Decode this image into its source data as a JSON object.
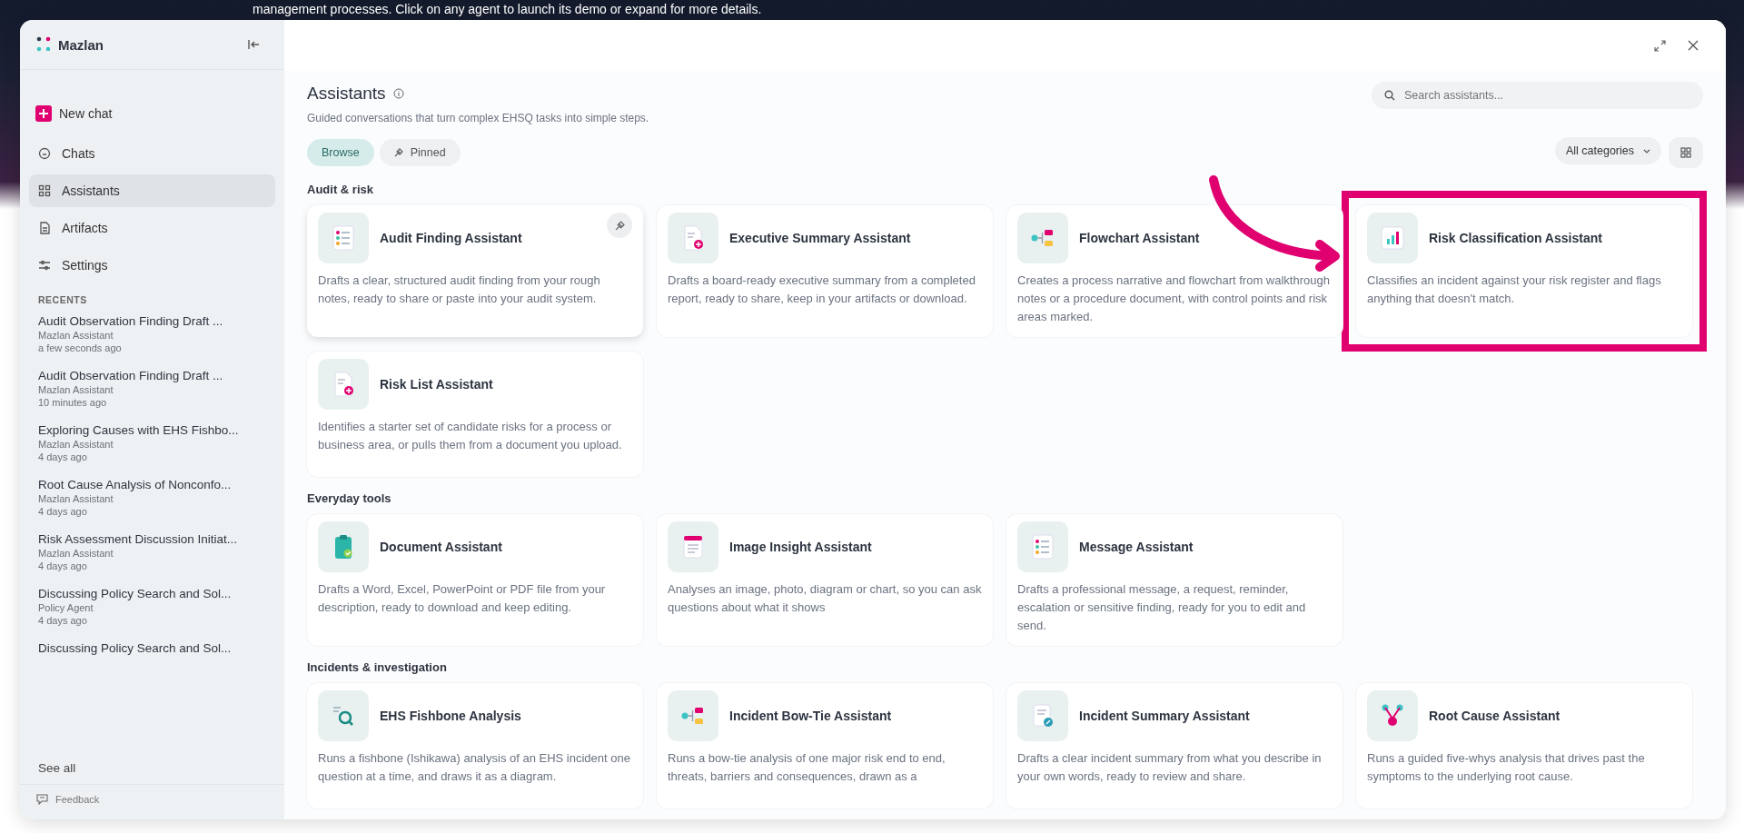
{
  "banner": {
    "text": "management processes. Click on any agent to launch its demo or expand for more details."
  },
  "sidebar": {
    "brand": "Mazlan",
    "new_chat": "New chat",
    "nav": [
      {
        "label": "Chats",
        "selected": false
      },
      {
        "label": "Assistants",
        "selected": true
      },
      {
        "label": "Artifacts",
        "selected": false
      },
      {
        "label": "Settings",
        "selected": false
      }
    ],
    "recents_heading": "RECENTS",
    "recents": [
      {
        "title": "Audit Observation Finding Draft ...",
        "agent": "Mazlan Assistant",
        "time": "a few seconds ago"
      },
      {
        "title": "Audit Observation Finding Draft ...",
        "agent": "Mazlan Assistant",
        "time": "10 minutes ago"
      },
      {
        "title": "Exploring Causes with EHS Fishbo...",
        "agent": "Mazlan Assistant",
        "time": "4 days ago"
      },
      {
        "title": "Root Cause Analysis of Nonconfo...",
        "agent": "Mazlan Assistant",
        "time": "4 days ago"
      },
      {
        "title": "Risk Assessment Discussion Initiat...",
        "agent": "Mazlan Assistant",
        "time": "4 days ago"
      },
      {
        "title": "Discussing Policy Search and Sol...",
        "agent": "Policy Agent",
        "time": "4 days ago"
      },
      {
        "title": "Discussing Policy Search and Sol..."
      }
    ],
    "see_all": "See all",
    "feedback": "Feedback"
  },
  "main": {
    "title": "Assistants",
    "subtitle": "Guided conversations that turn complex EHSQ tasks into simple steps.",
    "search": {
      "placeholder": "Search assistants..."
    },
    "tabs": [
      {
        "label": "Browse",
        "selected": true
      },
      {
        "label": "Pinned",
        "selected": false
      }
    ],
    "category_filter": "All categories",
    "sections": [
      {
        "heading": "Audit & risk",
        "cards": [
          {
            "title": "Audit Finding Assistant",
            "description": "Drafts a clear, structured audit finding from your rough notes, ready to share or paste into your audit system.",
            "hovered": true,
            "highlighted": false
          },
          {
            "title": "Executive Summary Assistant",
            "description": "Drafts a board-ready executive summary from a completed report, ready to share, keep in your artifacts or download.",
            "hovered": false,
            "highlighted": false
          },
          {
            "title": "Flowchart Assistant",
            "description": "Creates a process narrative and flowchart from walkthrough notes or a procedure document, with control points and risk areas marked.",
            "hovered": false,
            "highlighted": false
          },
          {
            "title": "Risk Classification Assistant",
            "description": "Classifies an incident against your risk register and flags anything that doesn't match.",
            "hovered": false,
            "highlighted": true
          },
          {
            "title": "Risk List Assistant",
            "description": "Identifies a starter set of candidate risks for a process or business area, or pulls them from a document you upload.",
            "hovered": false,
            "highlighted": false
          }
        ]
      },
      {
        "heading": "Everyday tools",
        "cards": [
          {
            "title": "Document Assistant",
            "description": "Drafts a Word, Excel, PowerPoint or PDF file from your description, ready to download and keep editing.",
            "hovered": false,
            "highlighted": false
          },
          {
            "title": "Image Insight Assistant",
            "description": "Analyses an image, photo, diagram or chart, so you can ask questions about what it shows",
            "hovered": false,
            "highlighted": false
          },
          {
            "title": "Message Assistant",
            "description": "Drafts a professional message, a request, reminder, escalation or sensitive finding, ready for you to edit and send.",
            "hovered": false,
            "highlighted": false
          }
        ]
      },
      {
        "heading": "Incidents & investigation",
        "cards": [
          {
            "title": "EHS Fishbone Analysis",
            "description": "Runs a fishbone (Ishikawa) analysis of an EHS incident one question at a time, and draws it as a diagram.",
            "hovered": false,
            "highlighted": false
          },
          {
            "title": "Incident Bow-Tie Assistant",
            "description": "Runs a bow-tie analysis of one major risk end to end, threats, barriers and consequences, drawn as a",
            "hovered": false,
            "highlighted": false
          },
          {
            "title": "Incident Summary Assistant",
            "description": "Drafts a clear incident summary from what you describe in your own words, ready to review and share.",
            "hovered": false,
            "highlighted": false
          },
          {
            "title": "Root Cause Assistant",
            "description": "Runs a guided five-whys analysis that drives past the symptoms to the underlying root cause.",
            "hovered": false,
            "highlighted": false
          }
        ]
      }
    ]
  }
}
